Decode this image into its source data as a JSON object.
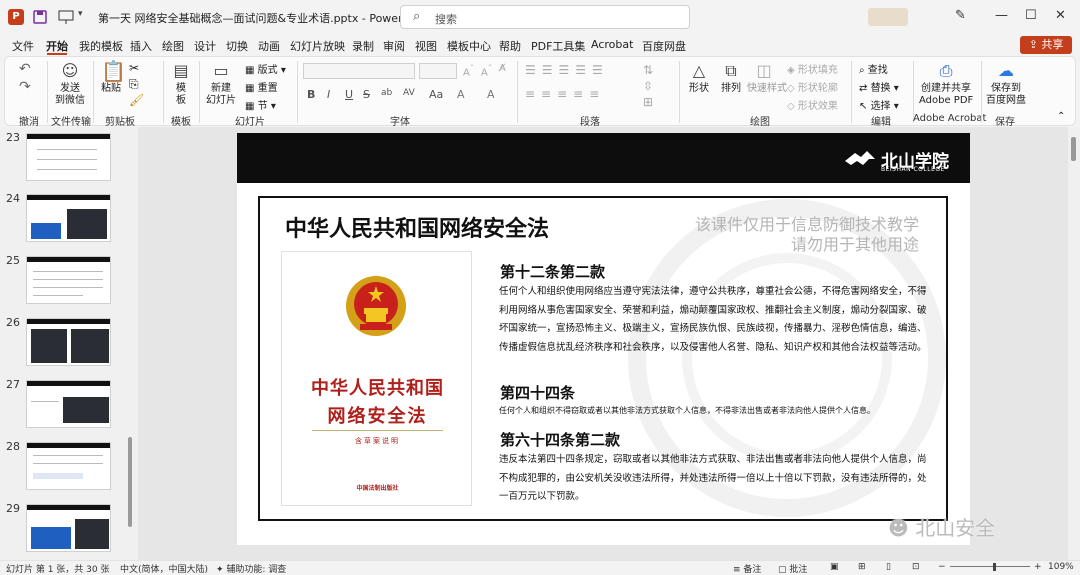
{
  "titlebar": {
    "app_logo": "P",
    "document": "第一天 网络安全基础概念—面试问题&专业术语.pptx",
    "app": "PowerPoint",
    "search_placeholder": "搜索",
    "icons": [
      "powerpoint-icon",
      "save-icon",
      "slideshow-icon",
      "dropdown-icon",
      "pen-icon",
      "minimize-icon",
      "maximize-icon",
      "close-icon"
    ]
  },
  "menu": {
    "items": [
      "文件",
      "开始",
      "我的模板",
      "插入",
      "绘图",
      "设计",
      "切换",
      "动画",
      "幻灯片放映",
      "录制",
      "审阅",
      "视图",
      "模板中心",
      "帮助",
      "PDF工具集",
      "Acrobat",
      "百度网盘"
    ],
    "active": "开始",
    "share": "共享"
  },
  "ribbon": {
    "groups": {
      "undo": "撤消",
      "transfer": "文件传输",
      "clipboard": "剪贴板",
      "template": "模板",
      "slides": "幻灯片",
      "font": "字体",
      "paragraph": "段落",
      "drawing": "绘图",
      "edit": "编辑",
      "acrobat": "Adobe Acrobat",
      "save": "保存"
    },
    "buttons": {
      "send_wechat": "发送\n到微信",
      "paste": "粘贴",
      "template": "模\n板",
      "new_slide": "新建\n幻灯片",
      "layout": "版式",
      "reset": "重置",
      "section": "节",
      "shape": "形状",
      "arrange": "排列",
      "quick_style": "快速样式",
      "shape_fill": "形状填充",
      "shape_outline": "形状轮廓",
      "shape_effect": "形状效果",
      "find": "查找",
      "replace": "替换",
      "select": "选择",
      "create_pdf": "创建并共享\nAdobe PDF",
      "save_baidu": "保存到\n百度网盘"
    },
    "font_format": [
      "B",
      "I",
      "U",
      "S",
      "ab",
      "AV",
      "Aa",
      "A",
      "A"
    ]
  },
  "thumbnails": {
    "numbers": [
      "23",
      "24",
      "25",
      "26",
      "27",
      "28",
      "29"
    ]
  },
  "slide": {
    "logo": "北山学院",
    "logo_sub": "BEISHAN COLLEGE",
    "title": "中华人民共和国网络安全法",
    "watermark_line1": "该课件仅用于信息防御技术教学",
    "watermark_line2": "请勿用于其他用途",
    "book": {
      "title_line1": "中华人民共和国",
      "title_line2": "网络安全法",
      "subtitle": "含草案说明",
      "publisher": "中国法制出版社"
    },
    "sections": [
      {
        "heading": "第十二条第二款",
        "body": "任何个人和组织使用网络应当遵守宪法法律，遵守公共秩序，尊重社会公德，不得危害网络安全，不得利用网络从事危害国家安全、荣誉和利益，煽动颠覆国家政权、推翻社会主义制度，煽动分裂国家、破坏国家统一，宣扬恐怖主义、极端主义，宣扬民族仇恨、民族歧视，传播暴力、淫秽色情信息，编造、传播虚假信息扰乱经济秩序和社会秩序，以及侵害他人名誉、隐私、知识产权和其他合法权益等活动。"
      },
      {
        "heading": "第四十四条",
        "body": "任何个人和组织不得窃取或者以其他非法方式获取个人信息，不得非法出售或者非法向他人提供个人信息。"
      },
      {
        "heading": "第六十四条第二款",
        "body": "违反本法第四十四条规定，窃取或者以其他非法方式获取、非法出售或者非法向他人提供个人信息，尚不构成犯罪的，由公安机关没收违法所得，并处违法所得一倍以上十倍以下罚款，没有违法所得的，处一百万元以下罚款。"
      }
    ]
  },
  "overlay_watermark": "北山安全",
  "status": {
    "slide_info": "幻灯片 第 1 张，共 30 张",
    "language": "中文(简体，中国大陆)",
    "accessibility": "辅助功能: 调查",
    "notes": "备注",
    "comments": "批注",
    "zoom": "109%",
    "zoom_fraction": 0.55
  },
  "colors": {
    "accent": "#c43e1c",
    "book_red": "#b0201b",
    "header_black": "#0d0d0d"
  }
}
